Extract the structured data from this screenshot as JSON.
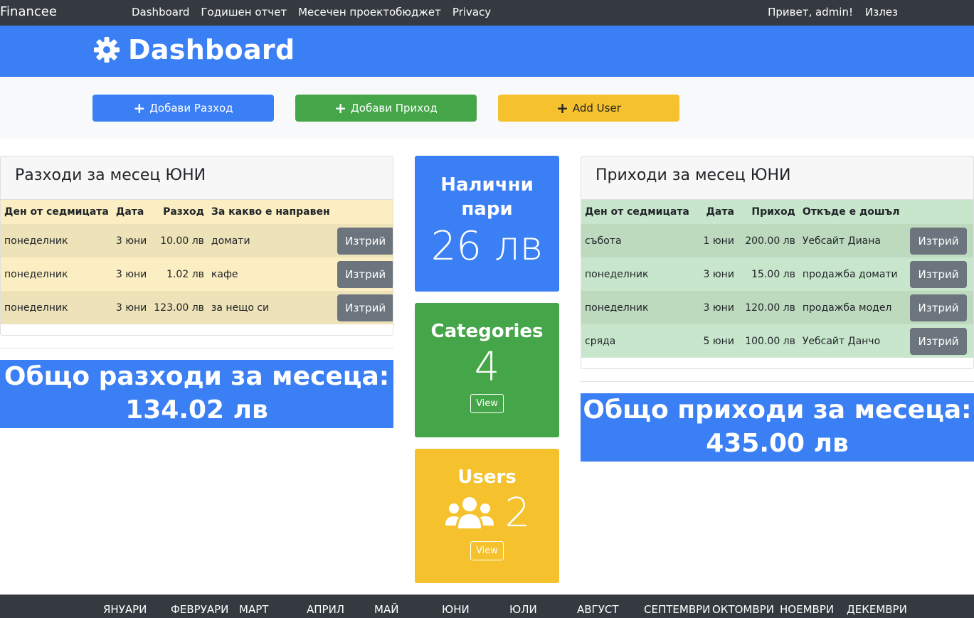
{
  "navbar": {
    "brand": "Financee",
    "links": [
      "Dashboard",
      "Годишен отчет",
      "Месечен проектобюджет",
      "Privacy"
    ],
    "greeting": "Привет, admin!",
    "logout": "Излез"
  },
  "header": {
    "title": "Dashboard",
    "icon": "gear-icon"
  },
  "actions": {
    "add_expense": "Добави Разход",
    "add_income": "Добави Приход",
    "add_user": "Add User"
  },
  "expenses": {
    "title": "Разходи за месец ЮНИ",
    "columns": [
      "Ден от седмицата",
      "Дата",
      "Разход",
      "За какво е направен"
    ],
    "rows": [
      {
        "day": "понеделник",
        "date": "3 юни",
        "amount": "10.00 лв",
        "purpose": "домати",
        "action": "Изтрий"
      },
      {
        "day": "понеделник",
        "date": "3 юни",
        "amount": "1.02 лв",
        "purpose": "кафе",
        "action": "Изтрий"
      },
      {
        "day": "понеделник",
        "date": "3 юни",
        "amount": "123.00 лв",
        "purpose": "за нещо си",
        "action": "Изтрий"
      }
    ],
    "total_label": "Общо разходи за месеца:",
    "total_value": "134.02 лв"
  },
  "income": {
    "title": "Приходи за месец ЮНИ",
    "columns": [
      "Ден от седмицата",
      "Дата",
      "Приход",
      "Откъде е дошъл"
    ],
    "rows": [
      {
        "day": "събота",
        "date": "1 юни",
        "amount": "200.00 лв",
        "source": "Уебсайт Диана",
        "action": "Изтрий"
      },
      {
        "day": "понеделник",
        "date": "3 юни",
        "amount": "15.00 лв",
        "source": "продажба домати",
        "action": "Изтрий"
      },
      {
        "day": "понеделник",
        "date": "3 юни",
        "amount": "120.00 лв",
        "source": "продажба модел",
        "action": "Изтрий"
      },
      {
        "day": "сряда",
        "date": "5 юни",
        "amount": "100.00 лв",
        "source": "Уебсайт Данчо",
        "action": "Изтрий"
      }
    ],
    "total_label": "Общо приходи за месеца:",
    "total_value": "435.00 лв"
  },
  "tiles": {
    "cash": {
      "title": "Налични пари",
      "value": "26 лв"
    },
    "categories": {
      "title": "Categories",
      "value": "4",
      "view": "View"
    },
    "users": {
      "title": "Users",
      "value": "2",
      "view": "View",
      "icon": "users-icon"
    }
  },
  "months": [
    "ЯНУАРИ",
    "ФЕВРУАРИ",
    "МАРТ",
    "АПРИЛ",
    "МАЙ",
    "ЮНИ",
    "ЮЛИ",
    "АВГУСТ",
    "СЕПТЕМВРИ",
    "ОКТОМВРИ",
    "НОЕМВРИ",
    "ДЕКЕМВРИ"
  ],
  "colors": {
    "primary": "#3b7ff5",
    "success": "#45a649",
    "warning": "#f5c12c",
    "dark": "#343a40",
    "secondary": "#6c757d"
  }
}
